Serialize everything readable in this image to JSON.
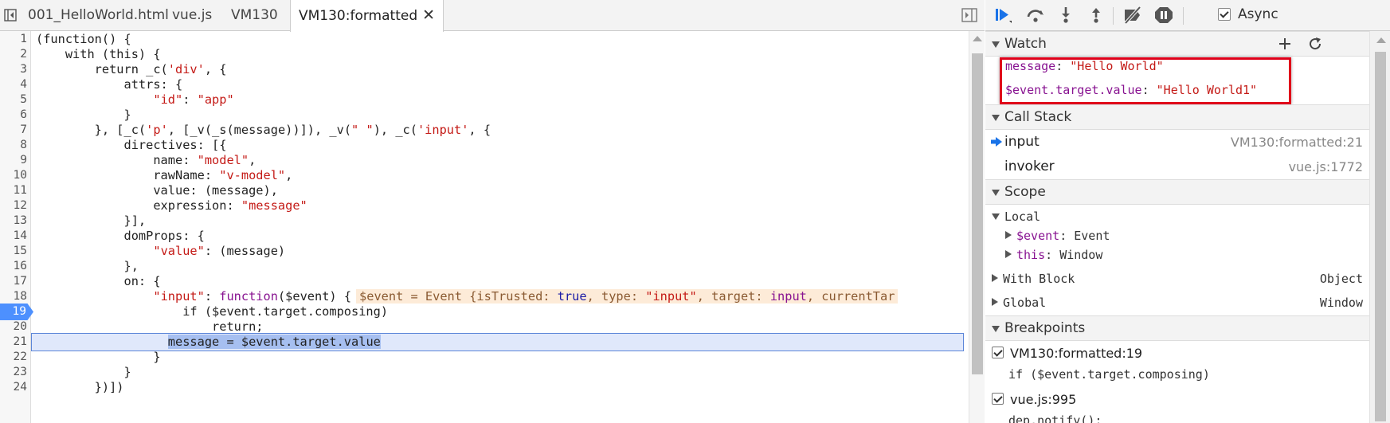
{
  "tabs": [
    {
      "label": "001_HelloWorld.html"
    },
    {
      "label": "vue.js"
    },
    {
      "label": "VM130"
    },
    {
      "label": "VM130:formatted"
    }
  ],
  "tab_close_glyph": "✕",
  "code": {
    "line_numbers": [
      "1",
      "2",
      "3",
      "4",
      "5",
      "6",
      "7",
      "8",
      "9",
      "10",
      "11",
      "12",
      "13",
      "14",
      "15",
      "16",
      "17",
      "18",
      "19",
      "20",
      "21",
      "22",
      "23",
      "24"
    ],
    "breakpoint_line": "19",
    "execution_line": "21",
    "l1": "(function() {",
    "l2a": "    with (this) {",
    "l3a": "        return _c(",
    "l3s": "'div'",
    "l3b": ", {",
    "l4": "            attrs: {",
    "l5s1": "\"id\"",
    "l5b": ": ",
    "l5s2": "\"app\"",
    "l6": "            }",
    "l7a": "        }, [_c(",
    "l7s1": "'p'",
    "l7b": ", [_v(_s(message))]), _v(",
    "l7s2": "\" \"",
    "l7c": "), _c(",
    "l7s3": "'input'",
    "l7d": ", {",
    "l8": "            directives: [{",
    "l9a": "                name: ",
    "l9s": "\"model\"",
    "l9b": ",",
    "l10a": "                rawName: ",
    "l10s": "\"v-model\"",
    "l10b": ",",
    "l11": "                value: (message),",
    "l12a": "                expression: ",
    "l12s": "\"message\"",
    "l13": "            }],",
    "l14": "            domProps: {",
    "l15s": "\"value\"",
    "l15b": ": (message)",
    "l16": "            },",
    "l17": "            on: {",
    "l18s": "\"input\"",
    "l18b": ": ",
    "l18kw": "function",
    "l18c": "($event) {",
    "l18_inline": {
      "a": "$event = Event {isTrusted: ",
      "b": "true",
      "c": ", type: ",
      "d": "\"input\"",
      "e": ", target: ",
      "f": "input",
      "g": ", currentTar"
    },
    "l19": "                    if ($event.target.composing)",
    "l20": "                        return;",
    "l21": "message = $event.target.value",
    "l22": "                }",
    "l23": "            }",
    "l24": "        })])"
  },
  "debugger": {
    "async_label": "Async",
    "watch": {
      "title": "Watch",
      "items": [
        {
          "name": "message",
          "value": "\"Hello World\""
        },
        {
          "name": "$event.target.value",
          "value": "\"Hello World1\""
        }
      ]
    },
    "call_stack": {
      "title": "Call Stack",
      "frames": [
        {
          "name": "input",
          "location": "VM130:formatted:21"
        },
        {
          "name": "invoker",
          "location": "vue.js:1772"
        }
      ]
    },
    "scope": {
      "title": "Scope",
      "local_label": "Local",
      "local_items": [
        {
          "name": "$event",
          "value": "Event"
        },
        {
          "name": "this",
          "value": "Window"
        }
      ],
      "with_block": {
        "name": "With Block",
        "value": "Object"
      },
      "global": {
        "name": "Global",
        "value": "Window"
      }
    },
    "breakpoints": {
      "title": "Breakpoints",
      "items": [
        {
          "location": "VM130:formatted:19",
          "code": "if ($event.target.composing)"
        },
        {
          "location": "vue.js:995",
          "code": "dep.notify();"
        }
      ]
    }
  },
  "colors": {
    "breakpoint_marker": "#4d90fe",
    "exec_line_bg": "#e0e8fb",
    "string": "#c41a16",
    "keyword": "#881391",
    "highlight_box": "#e0001a",
    "toolbar_blue": "#1a73e8"
  }
}
